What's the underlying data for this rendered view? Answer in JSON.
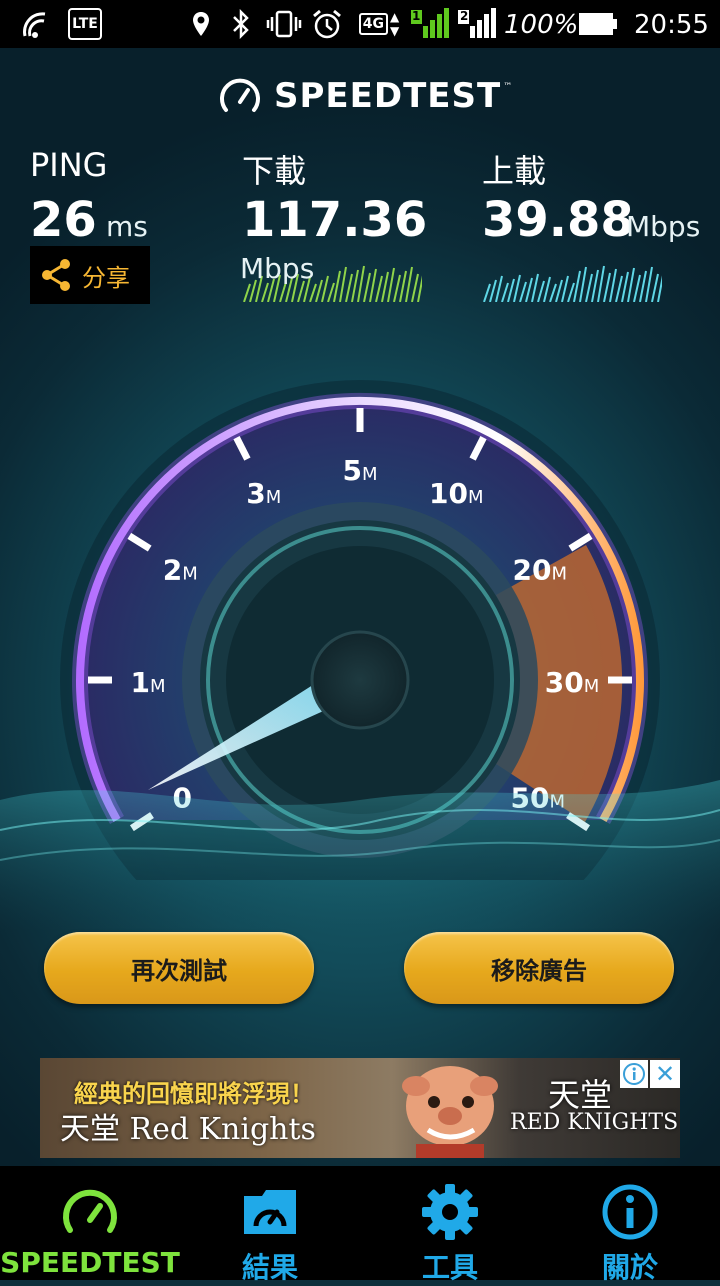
{
  "status_bar": {
    "carrier_badge": "LTE",
    "network": "4G",
    "sim1": "1",
    "sim2": "2",
    "battery": "100%",
    "time": "20:55"
  },
  "header": {
    "logo_text": "SPEEDTEST",
    "trademark": "™"
  },
  "results": {
    "ping_label": "PING",
    "ping_value": "26",
    "ping_unit": "ms",
    "download_label": "下載",
    "download_value": "117.36",
    "download_unit": "Mbps",
    "upload_label": "上載",
    "upload_value": "39.88",
    "upload_unit": "Mbps"
  },
  "share": {
    "label": "分享"
  },
  "gauge": {
    "ticks": [
      {
        "num": "0",
        "unit": ""
      },
      {
        "num": "1",
        "unit": "M"
      },
      {
        "num": "2",
        "unit": "M"
      },
      {
        "num": "3",
        "unit": "M"
      },
      {
        "num": "5",
        "unit": "M"
      },
      {
        "num": "10",
        "unit": "M"
      },
      {
        "num": "20",
        "unit": "M"
      },
      {
        "num": "30",
        "unit": "M"
      },
      {
        "num": "50",
        "unit": "M"
      }
    ]
  },
  "buttons": {
    "retest": "再次測試",
    "remove_ads": "移除廣告"
  },
  "ad": {
    "headline": "經典的回憶即將浮現！",
    "title": "天堂 Red Knights",
    "logo_line1": "天堂",
    "logo_line2": "RED KNIGHTS"
  },
  "nav": {
    "items": [
      {
        "label": "SPEEDTEST"
      },
      {
        "label": "結果"
      },
      {
        "label": "工具"
      },
      {
        "label": "關於"
      }
    ],
    "active_color": "#7ee33d",
    "inactive_color": "#20a9e8"
  }
}
